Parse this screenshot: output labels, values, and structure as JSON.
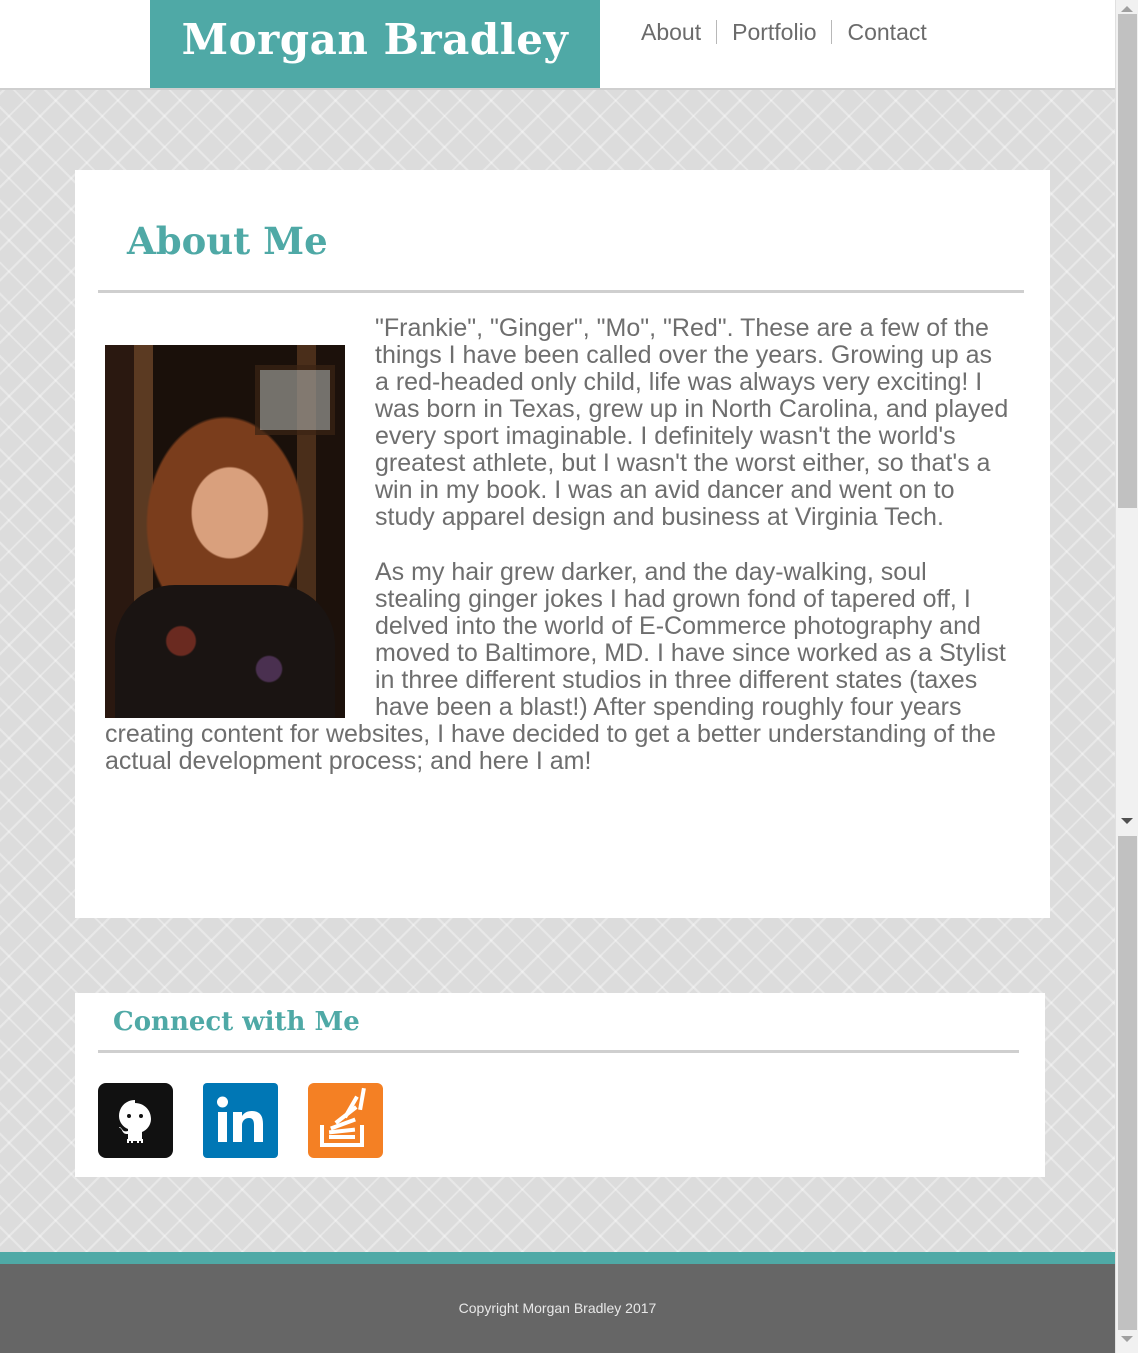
{
  "header": {
    "brand": "Morgan Bradley",
    "nav": [
      {
        "label": "About"
      },
      {
        "label": "Portfolio"
      },
      {
        "label": "Contact"
      }
    ]
  },
  "about": {
    "title": "About Me",
    "paragraphs": [
      "\"Frankie\", \"Ginger\", \"Mo\", \"Red\". These are a few of the things I have been called over the years. Growing up as a red-headed only child, life was always very exciting! I was born in Texas, grew up in North Carolina, and played every sport imaginable. I definitely wasn't the world's greatest athlete, but I wasn't the worst either, so that's a win in my book. I was an avid dancer and went on to study apparel design and business at Virginia Tech.",
      "As my hair grew darker, and the day-walking, soul stealing ginger jokes I had grown fond of tapered off, I delved into the world of E-Commerce photography and moved to Baltimore, MD. I have since worked as a Stylist in three different studios in three different states (taxes have been a blast!) After spending roughly four years creating content for websites, I have decided to get a better understanding of the actual development process; and here I am!"
    ]
  },
  "connect": {
    "title": "Connect with Me",
    "links": [
      {
        "icon": "github-icon"
      },
      {
        "icon": "linkedin-icon"
      },
      {
        "icon": "stackoverflow-icon"
      }
    ]
  },
  "footer": {
    "copyright": "Copyright Morgan Bradley 2017"
  },
  "colors": {
    "accent": "#4fa9a6",
    "footer": "#666666",
    "linkedin": "#0077b5",
    "stackoverflow": "#f48024",
    "github": "#111111"
  }
}
